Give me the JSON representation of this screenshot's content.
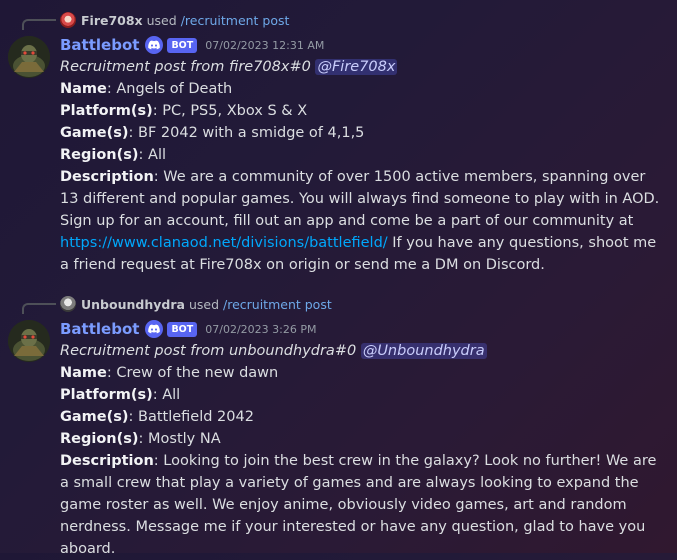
{
  "messages": [
    {
      "reply_user": "Fire708x",
      "reply_used": "used",
      "reply_command": "/recruitment post",
      "bot_name": "Battlebot",
      "bot_badge": "BOT",
      "timestamp": "07/02/2023 12:31 AM",
      "intro": "Recruitment post from fire708x#0",
      "mention": "@Fire708x",
      "name_label": "Name",
      "name_value": ": Angels of Death",
      "platform_label": "Platform(s)",
      "platform_value": ": PC, PS5, Xbox S & X",
      "games_label": "Game(s)",
      "games_value": ": BF 2042 with a smidge of 4,1,5",
      "region_label": "Region(s)",
      "region_value": ": All",
      "desc_label": "Description",
      "desc_text": ": We are a community of over 1500 active members, spanning over 13 different and popular games. You will always find someone to play with in AOD. Sign up for an account, fill out an app and come be a part of our community at",
      "desc_link": "https://www.clanaod.net/divisions/battlefield/",
      "desc_after": " If you have any questions, shoot me a friend request at Fire708x on origin or send me a DM on Discord."
    },
    {
      "reply_user": "Unboundhydra",
      "reply_used": "used",
      "reply_command": "/recruitment post",
      "bot_name": "Battlebot",
      "bot_badge": "BOT",
      "timestamp": "07/02/2023 3:26 PM",
      "intro": "Recruitment post from unboundhydra#0",
      "mention": "@Unboundhydra",
      "name_label": "Name",
      "name_value": ": Crew of the new dawn",
      "platform_label": "Platform(s)",
      "platform_value": ": All",
      "games_label": "Game(s)",
      "games_value": ": Battlefield 2042",
      "region_label": "Region(s)",
      "region_value": ": Mostly NA",
      "desc_label": "Description",
      "desc_text": ": Looking to join the best crew in the galaxy? Look no further! We are a small crew that play a variety of games and are always looking to expand the game roster as well. We enjoy anime, obviously video games, art and random nerdness. Message me if your interested or have any question, glad to have you aboard."
    }
  ]
}
